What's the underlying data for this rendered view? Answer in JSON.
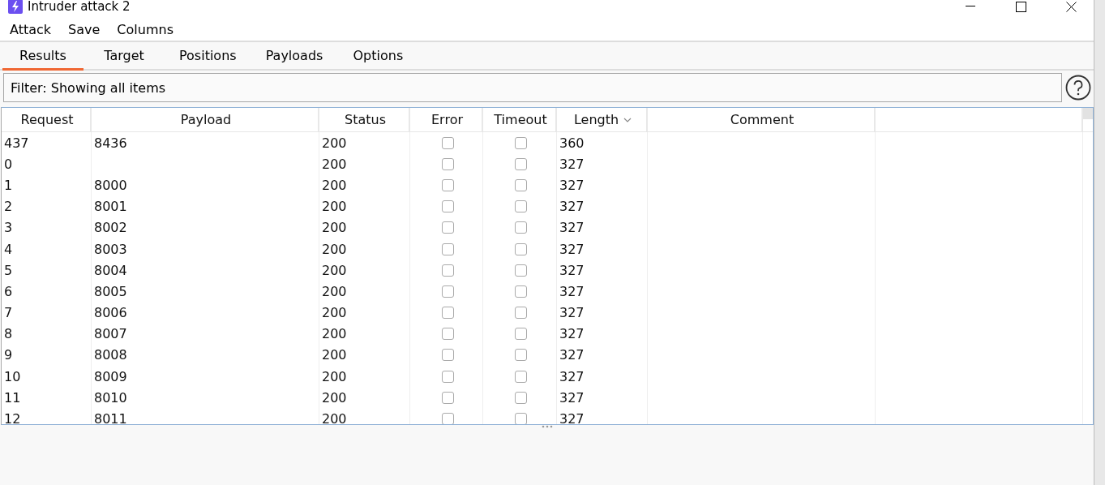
{
  "window": {
    "title": "Intruder attack 2"
  },
  "menu": [
    "Attack",
    "Save",
    "Columns"
  ],
  "tabs": [
    {
      "label": "Results",
      "selected": true
    },
    {
      "label": "Target",
      "selected": false
    },
    {
      "label": "Positions",
      "selected": false
    },
    {
      "label": "Payloads",
      "selected": false
    },
    {
      "label": "Options",
      "selected": false
    }
  ],
  "filter": {
    "text": "Filter: Showing all items"
  },
  "table": {
    "columns": [
      {
        "label": "Request",
        "sorted": false
      },
      {
        "label": "Payload",
        "sorted": false
      },
      {
        "label": "Status",
        "sorted": false
      },
      {
        "label": "Error",
        "sorted": false
      },
      {
        "label": "Timeout",
        "sorted": false
      },
      {
        "label": "Length",
        "sorted": true
      },
      {
        "label": "Comment",
        "sorted": false
      }
    ],
    "rows": [
      {
        "request": "437",
        "payload": "8436",
        "status": "200",
        "error": false,
        "timeout": false,
        "length": "360"
      },
      {
        "request": "0",
        "payload": "",
        "status": "200",
        "error": false,
        "timeout": false,
        "length": "327"
      },
      {
        "request": "1",
        "payload": "8000",
        "status": "200",
        "error": false,
        "timeout": false,
        "length": "327"
      },
      {
        "request": "2",
        "payload": "8001",
        "status": "200",
        "error": false,
        "timeout": false,
        "length": "327"
      },
      {
        "request": "3",
        "payload": "8002",
        "status": "200",
        "error": false,
        "timeout": false,
        "length": "327"
      },
      {
        "request": "4",
        "payload": "8003",
        "status": "200",
        "error": false,
        "timeout": false,
        "length": "327"
      },
      {
        "request": "5",
        "payload": "8004",
        "status": "200",
        "error": false,
        "timeout": false,
        "length": "327"
      },
      {
        "request": "6",
        "payload": "8005",
        "status": "200",
        "error": false,
        "timeout": false,
        "length": "327"
      },
      {
        "request": "7",
        "payload": "8006",
        "status": "200",
        "error": false,
        "timeout": false,
        "length": "327"
      },
      {
        "request": "8",
        "payload": "8007",
        "status": "200",
        "error": false,
        "timeout": false,
        "length": "327"
      },
      {
        "request": "9",
        "payload": "8008",
        "status": "200",
        "error": false,
        "timeout": false,
        "length": "327"
      },
      {
        "request": "10",
        "payload": "8009",
        "status": "200",
        "error": false,
        "timeout": false,
        "length": "327"
      },
      {
        "request": "11",
        "payload": "8010",
        "status": "200",
        "error": false,
        "timeout": false,
        "length": "327"
      },
      {
        "request": "12",
        "payload": "8011",
        "status": "200",
        "error": false,
        "timeout": false,
        "length": "327"
      }
    ]
  }
}
